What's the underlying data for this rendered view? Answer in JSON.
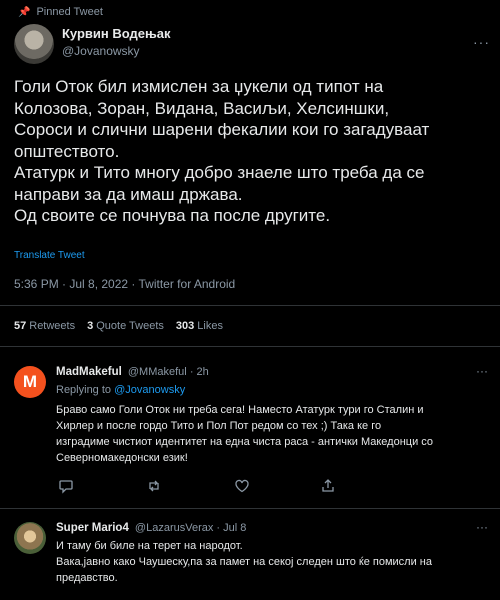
{
  "pinned_label": "Pinned Tweet",
  "main": {
    "author_name": "Курвин Водењак",
    "author_handle": "@Jovanowsky",
    "more": "···",
    "text_lines": [
      "Голи Оток бил измислен за џукели од типот на",
      "Колозова, Зоран, Видана, Васиљи, Хелсиншки,",
      "Сороси и слични шарени фекалии кои го загадуваат",
      "општеството.",
      "Ататурк и Тито многу добро знаеле што треба да се",
      "направи за да имаш држава.",
      "Од своите се почнува па после другите."
    ],
    "translate": "Translate Tweet",
    "meta": "5:36 PM · Jul 8, 2022 · Twitter for Android",
    "retweets_count": "57",
    "retweets_label": "Retweets",
    "quotes_count": "3",
    "quotes_label": "Quote Tweets",
    "likes_count": "303",
    "likes_label": "Likes"
  },
  "reply1": {
    "avatar_letter": "M",
    "name": "MadMakeful",
    "handle": "@MMakeful",
    "time": "· 2h",
    "more": "···",
    "replying_prefix": "Replying to",
    "replying_handle": "@Jovanowsky",
    "lines": [
      "Браво само Голи Оток ни треба сега! Наместо Ататурк тури го Сталин и",
      "Хирлер и после гордо Тито и Пол Пот редом со тех ;) Така ке го",
      "изградиме чистиот идентитет на една чиста раса - антички Македонци со",
      "Северномакедонски език!"
    ]
  },
  "reply2": {
    "name": "Super Mario4",
    "handle": "@LazarusVerax",
    "time": "· Jul 8",
    "more": "···",
    "lines": [
      "И таму би биле на терет на народот.",
      "Вака,јавно како Чаушеску,па за памет на секој следен што ќе помисли на",
      "предавство."
    ]
  }
}
